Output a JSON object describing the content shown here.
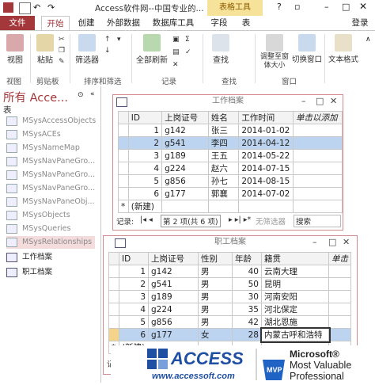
{
  "window": {
    "title": "Access软件网--中国专业的...",
    "context_tab": "表格工具",
    "login": "登录"
  },
  "tabs": [
    "文件",
    "开始",
    "创建",
    "外部数据",
    "数据库工具",
    "字段",
    "表"
  ],
  "ribbon": {
    "view": "视图",
    "paste": "粘贴",
    "filter": "筛选器",
    "refresh_all": "全部刷新",
    "find": "查找",
    "resize": "调整至窗体大小",
    "switch_window": "切换窗口",
    "text_format": "文本格式",
    "groups": [
      "视图",
      "剪贴板",
      "排序和筛选",
      "记录",
      "查找",
      "窗口"
    ]
  },
  "nav": {
    "title": "所有 Acce...",
    "section": "表",
    "items": [
      "MSysAccessObjects",
      "MSysACEs",
      "MSysNameMap",
      "MSysNavPaneGro...",
      "MSysNavPaneGro...",
      "MSysNavPaneGro...",
      "MSysNavPaneObj...",
      "MSysObjects",
      "MSysQueries",
      "MSysRelationships",
      "工作档案",
      "职工档案"
    ]
  },
  "work_table": {
    "title": "工作档案",
    "headers": [
      "ID",
      "上岗证号",
      "姓名",
      "工作时间",
      "单击以添加"
    ],
    "rows": [
      [
        "1",
        "g142",
        "张三",
        "2014-01-02"
      ],
      [
        "2",
        "g541",
        "李四",
        "2014-04-12"
      ],
      [
        "3",
        "g189",
        "王五",
        "2014-05-22"
      ],
      [
        "4",
        "g224",
        "赵六",
        "2014-07-15"
      ],
      [
        "5",
        "g856",
        "孙七",
        "2014-08-15"
      ],
      [
        "6",
        "g177",
        "郭襄",
        "2014-07-02"
      ]
    ],
    "new_row": "(新建)",
    "record_label": "记录:",
    "record_pos": "第 2 项(共 6 项)",
    "no_filter": "无筛选器",
    "search": "搜索"
  },
  "staff_table": {
    "title": "职工档案",
    "headers": [
      "ID",
      "上岗证号",
      "性别",
      "年龄",
      "籍贯",
      "单击"
    ],
    "rows": [
      [
        "1",
        "g142",
        "男",
        "40",
        "云南大理"
      ],
      [
        "2",
        "g541",
        "男",
        "50",
        "昆明"
      ],
      [
        "3",
        "g189",
        "男",
        "30",
        "河南安阳"
      ],
      [
        "4",
        "g224",
        "男",
        "35",
        "河北保定"
      ],
      [
        "5",
        "g856",
        "男",
        "42",
        "湖北恩施"
      ],
      [
        "6",
        "g177",
        "女",
        "28",
        "内蒙古呼和浩特"
      ]
    ],
    "new_row": "(新建)",
    "record_label": "记录"
  },
  "banner": {
    "brand": "ACCESS",
    "url": "www.accessoft.com",
    "badge": "MVP",
    "line1": "Microsoft®",
    "line2": "Most Valuable",
    "line3": "Professional"
  },
  "colors": {
    "accent": "#a4373a",
    "selected_row": "#bcd4ef",
    "context_tab": "#f7e29a"
  }
}
